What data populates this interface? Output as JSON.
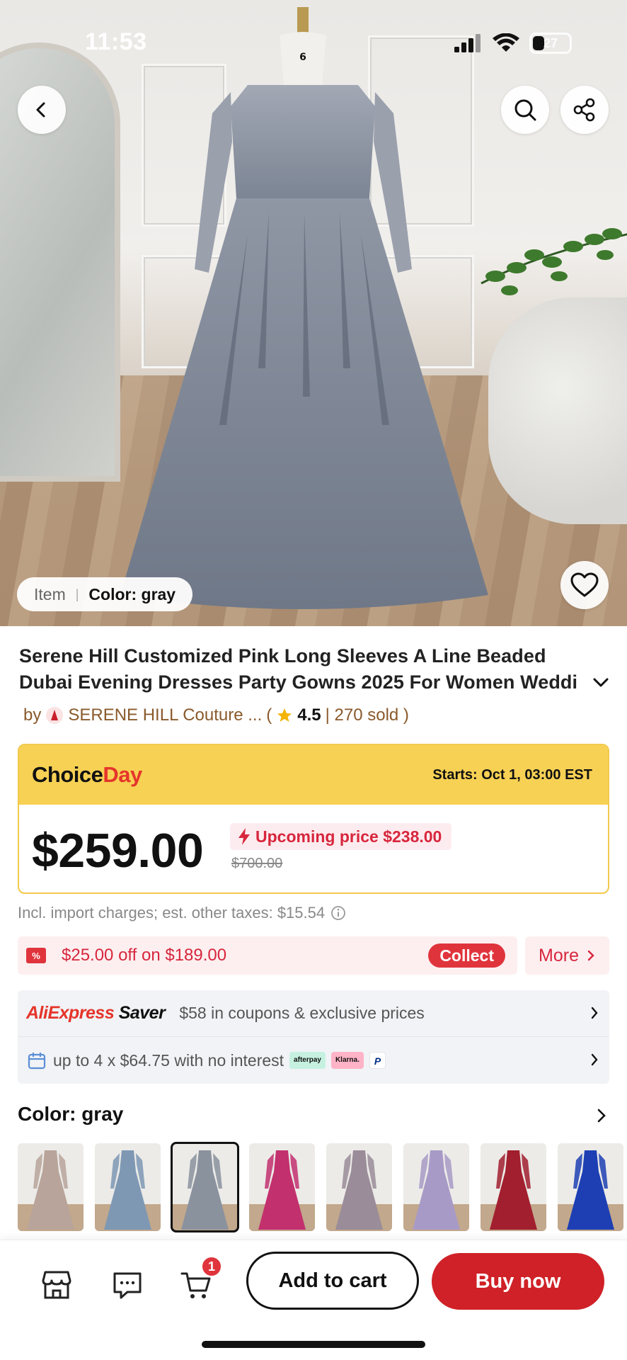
{
  "status_bar": {
    "time": "11:53",
    "battery": "27"
  },
  "hero": {
    "color_pill_item": "Item",
    "color_pill_sep": "|",
    "color_pill_color": "Color: gray",
    "mannequin_tag": "6"
  },
  "product": {
    "title_line1": "Serene Hill Customized Pink Long Sleeves A Line Beaded",
    "title_line2": "Dubai Evening Dresses Party Gowns 2025 For Women Weddi",
    "by_prefix": "by",
    "store_name": "SERENE HILL Couture ...",
    "rating_open": "(",
    "rating": "4.5",
    "sold": "| 270 sold )"
  },
  "choice": {
    "logo_choice": "Choice",
    "logo_day": "Day",
    "starts": "Starts: Oct 1, 03:00 EST",
    "price": "$259.00",
    "upcoming": "Upcoming price $238.00",
    "original_price": "$700.00"
  },
  "tax_note": "Incl. import charges; est. other taxes: $15.54",
  "coupon": {
    "tag": "%",
    "text": "$25.00 off on $189.00",
    "collect": "Collect",
    "more": "More"
  },
  "saver": {
    "logo_ali": "AliExpress",
    "logo_saver": "Saver",
    "text": "$58 in coupons & exclusive prices",
    "installments": "up to 4 x $64.75 with no interest",
    "badges": [
      "afterpay",
      "Klarna.",
      "P"
    ]
  },
  "color_section": {
    "title": "Color: gray",
    "selected_index": 2,
    "swatches": [
      "#b8a49a",
      "#7e98b4",
      "#8a929e",
      "#c2306e",
      "#9a8c98",
      "#a89ac6",
      "#a11f2e",
      "#1d3fb3"
    ]
  },
  "bottom_bar": {
    "cart_count": "1",
    "add_to_cart": "Add to cart",
    "buy_now": "Buy now"
  },
  "colors": {
    "accent_red": "#cf2127",
    "choice_yellow": "#f7d154",
    "price_red": "#d7263d"
  }
}
